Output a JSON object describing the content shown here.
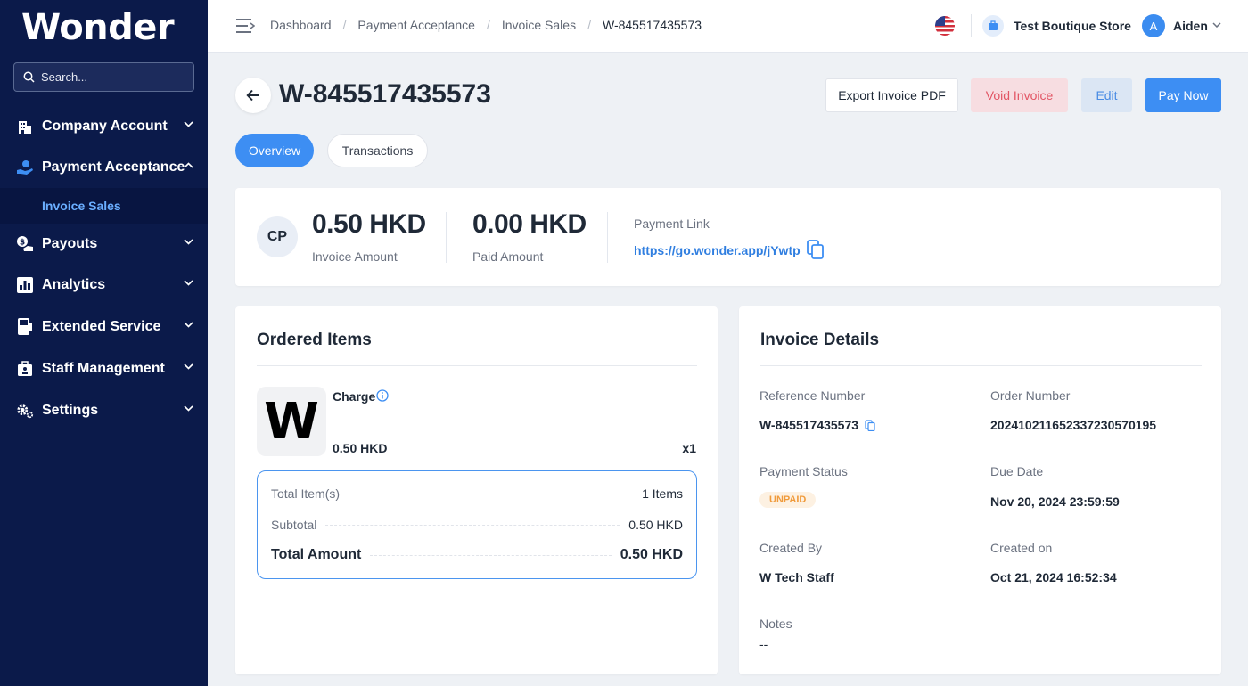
{
  "sidebar": {
    "logo": "Wonder",
    "search_placeholder": "Search...",
    "items": [
      {
        "label": "Company Account",
        "icon": "building-icon"
      },
      {
        "label": "Payment Acceptance",
        "icon": "hand-coin-icon"
      },
      {
        "label": "Payouts",
        "icon": "payouts-icon"
      },
      {
        "label": "Analytics",
        "icon": "bar-chart-icon"
      },
      {
        "label": "Extended Service",
        "icon": "pos-terminal-icon"
      },
      {
        "label": "Staff Management",
        "icon": "staff-icon"
      },
      {
        "label": "Settings",
        "icon": "gears-icon"
      }
    ],
    "sub_item": "Invoice Sales"
  },
  "topbar": {
    "breadcrumbs": [
      "Dashboard",
      "Payment Acceptance",
      "Invoice Sales",
      "W-845517435573"
    ],
    "store_name": "Test Boutique Store",
    "avatar_letter": "A",
    "user_name": "Aiden"
  },
  "header": {
    "title": "W-845517435573",
    "export_label": "Export Invoice PDF",
    "void_label": "Void Invoice",
    "edit_label": "Edit",
    "pay_label": "Pay Now"
  },
  "tabs": {
    "overview": "Overview",
    "transactions": "Transactions"
  },
  "summary": {
    "badge": "CP",
    "invoice_amount": "0.50 HKD",
    "invoice_amount_label": "Invoice Amount",
    "paid_amount": "0.00 HKD",
    "paid_amount_label": "Paid Amount",
    "payment_link_label": "Payment Link",
    "payment_link": "https://go.wonder.app/jYwtp"
  },
  "ordered_items": {
    "title": "Ordered Items",
    "thumb_letter": "W",
    "item_name": "Charge",
    "item_price": "0.50 HKD",
    "item_qty": "x1",
    "total_items_label": "Total Item(s)",
    "total_items_value": "1 Items",
    "subtotal_label": "Subtotal",
    "subtotal_value": "0.50 HKD",
    "total_amount_label": "Total Amount",
    "total_amount_value": "0.50 HKD"
  },
  "invoice_details": {
    "title": "Invoice Details",
    "reference_label": "Reference Number",
    "reference_value": "W-845517435573",
    "order_label": "Order Number",
    "order_value": "20241021165233723057019​5",
    "status_label": "Payment Status",
    "status_value": "UNPAID",
    "due_label": "Due Date",
    "due_value": "Nov 20, 2024 23:59:59",
    "created_by_label": "Created By",
    "created_by_value": "W Tech Staff",
    "created_on_label": "Created on",
    "created_on_value": "Oct 21, 2024 16:52:34",
    "notes_label": "Notes",
    "notes_value": "--"
  },
  "colors": {
    "sidebar_bg": "#0b1a4a",
    "accent": "#3d8ef3",
    "void": "#e25564",
    "unpaid": "#f09a3a"
  }
}
